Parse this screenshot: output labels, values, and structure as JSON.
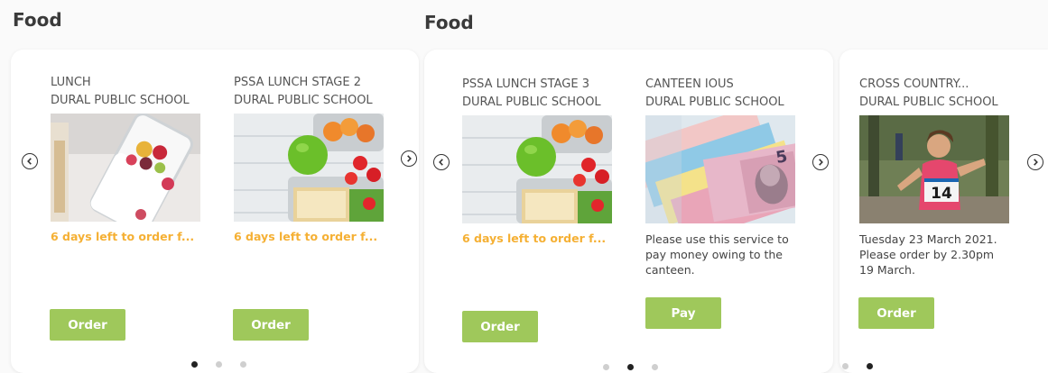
{
  "sections": [
    {
      "title": "Food"
    },
    {
      "title": "Food"
    }
  ],
  "cards": [
    {
      "name_line1": "LUNCH",
      "name_line2": "DURAL PUBLIC SCHOOL",
      "days_left": "6 days left to order f...",
      "button": "Order"
    },
    {
      "name_line1": "PSSA LUNCH STAGE 2",
      "name_line2": "DURAL PUBLIC SCHOOL",
      "days_left": "6 days left to order f...",
      "button": "Order"
    },
    {
      "name_line1": "PSSA LUNCH STAGE 3",
      "name_line2": "DURAL PUBLIC SCHOOL",
      "days_left": "6 days left to order f...",
      "button": "Order"
    },
    {
      "name_line1": "CANTEEN IOUS",
      "name_line2": "DURAL PUBLIC SCHOOL",
      "description": "Please use this service to pay money owing to the canteen.",
      "button": "Pay"
    },
    {
      "name_line1": "CROSS COUNTRY...",
      "name_line2": "DURAL PUBLIC SCHOOL",
      "description": "Tuesday 23 March 2021. Please order by 2.30pm 19 March.",
      "button": "Order",
      "bib_number": "14"
    }
  ],
  "carousels": [
    {
      "active_page": 1,
      "total_pages": 3
    },
    {
      "active_page": 2,
      "total_pages": 3
    },
    {
      "active_page": 2,
      "total_pages": 2
    }
  ],
  "colors": {
    "button": "#9fc85b",
    "days_left": "#f5b034",
    "dot_active": "#222222",
    "dot_inactive": "#cfcfcf"
  },
  "icons": {
    "prev": "chevron-left-circle-icon",
    "next": "chevron-right-circle-icon"
  }
}
